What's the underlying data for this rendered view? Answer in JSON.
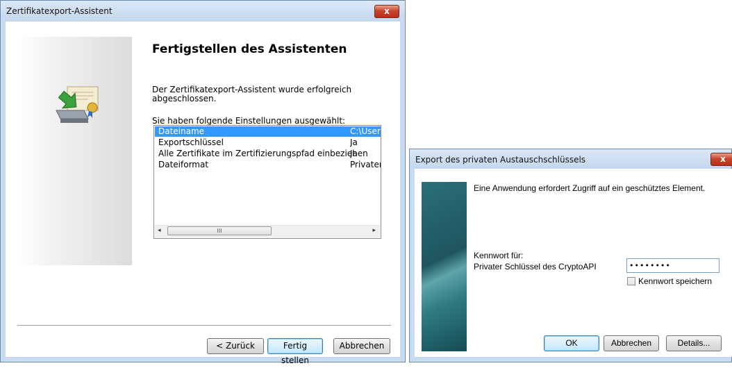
{
  "wizard": {
    "title": "Zertifikatexport-Assistent",
    "close_glyph": "x",
    "heading": "Fertigstellen des Assistenten",
    "description": "Der Zertifikatexport-Assistent wurde erfolgreich abgeschlossen.",
    "settings_label": "Sie haben folgende Einstellungen ausgewählt:",
    "settings": [
      {
        "name": "Dateiname",
        "value": "C:\\User",
        "selected": true
      },
      {
        "name": "Exportschlüssel",
        "value": "Ja",
        "selected": false
      },
      {
        "name": "Alle Zertifikate im Zertifizierungspfad einbeziehen",
        "value": "Ja",
        "selected": false
      },
      {
        "name": "Dateiformat",
        "value": "Privater",
        "selected": false
      }
    ],
    "scroll_left": "◂",
    "scroll_thumb": "III",
    "scroll_right": "▸",
    "icon": "certificate-export-icon",
    "buttons": {
      "back": "< Zurück",
      "finish": "Fertig stellen",
      "cancel": "Abbrechen"
    }
  },
  "key_dialog": {
    "title": "Export des privaten Austauschschlüssels",
    "close_glyph": "x",
    "message": "Eine Anwendung erfordert Zugriff auf ein geschütztes Element.",
    "password_for_label": "Kennwort für:",
    "password_for_value": "Privater Schlüssel des CryptoAPI",
    "password_value": "••••••••",
    "remember_label": "Kennwort speichern",
    "remember_checked": false,
    "buttons": {
      "ok": "OK",
      "cancel": "Abbrechen",
      "details": "Details..."
    }
  }
}
